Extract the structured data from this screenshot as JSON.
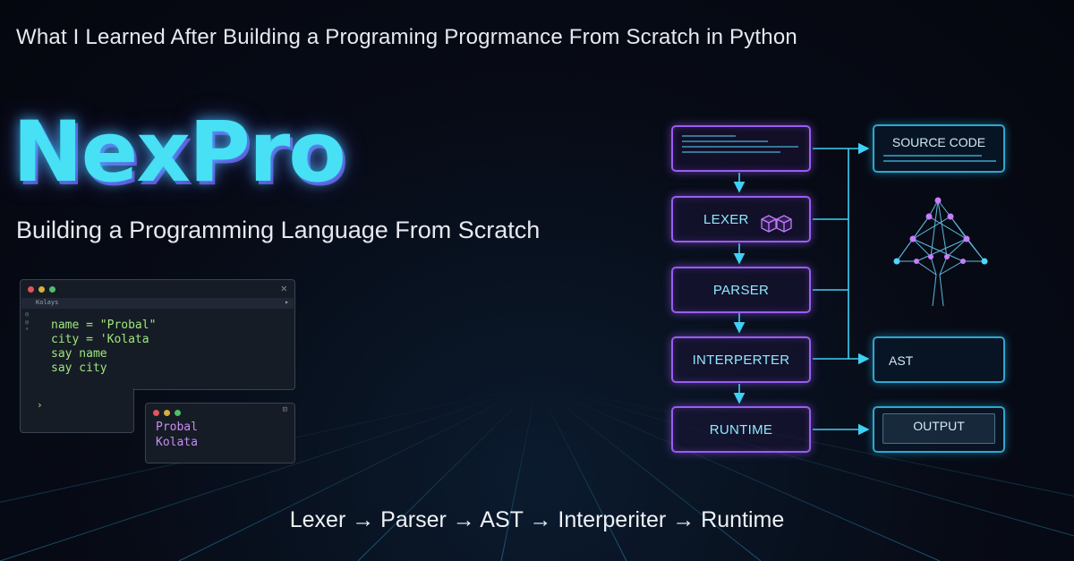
{
  "page": {
    "title": "What I Learned After Building a Programing Progrmance From Scratch in Python",
    "brand": "NexPro",
    "subtitle": "Building a Programming Language From Scratch",
    "pipeline": "Lexer → Parser → AST → Interperiter → Runtime"
  },
  "editor": {
    "tab_label": "Kolays",
    "gutter": [
      "◎",
      "◎",
      "⁶"
    ],
    "code": "name = \"Probal\"\ncity = 'Kolata\nsay name\nsay city",
    "prompt_1": "›",
    "prompt_2": "›",
    "close_glyph": "✕",
    "arrow_glyph": "▸"
  },
  "output_window": {
    "text": "Probal\nKolata",
    "corner_glyph": "⊡"
  },
  "flow": {
    "stages": [
      "LEXER",
      "PARSER",
      "INTERPERTER",
      "RUNTIME"
    ],
    "right": {
      "source": "SOURCE CODE",
      "ast": "AST",
      "output": "OUTPUT"
    }
  },
  "colors": {
    "brand": "#47e0f5",
    "accent_purple": "#9a5df1",
    "accent_cyan": "#2fc8ff",
    "code_green": "#9fe87d",
    "output_purple": "#c98cf2"
  },
  "icons": [
    "cube-icon",
    "tree-network-icon",
    "arrow-icon"
  ]
}
